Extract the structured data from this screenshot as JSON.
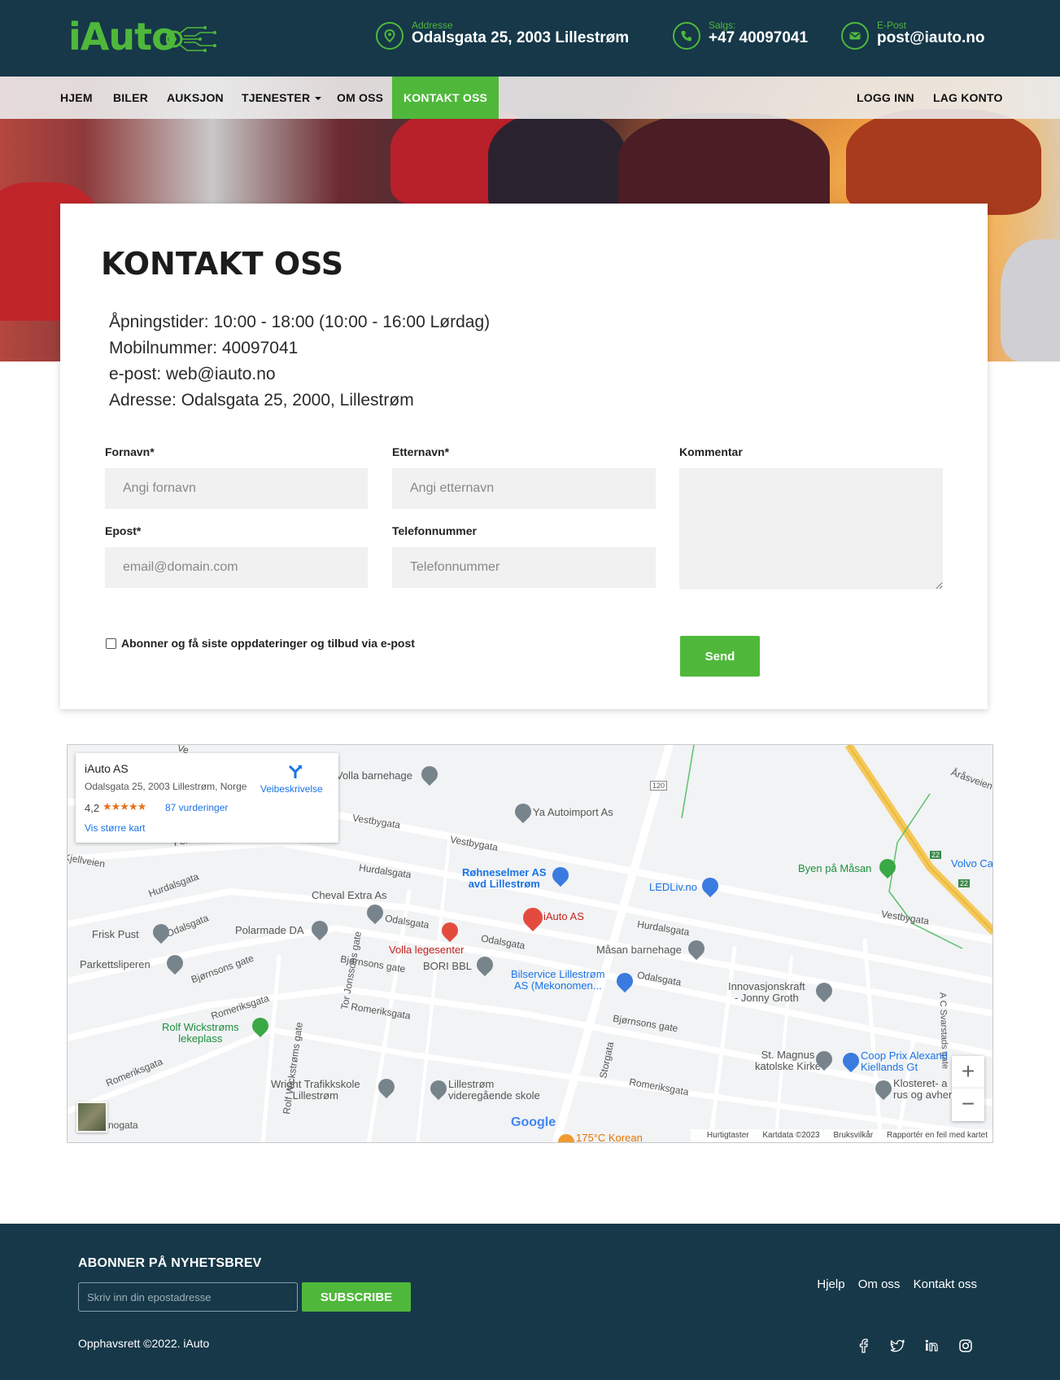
{
  "header": {
    "logo": "iAuto",
    "contacts": [
      {
        "label": "Addresse",
        "value": "Odalsgata 25, 2003 Lillestrøm",
        "icon": "location-pin-icon"
      },
      {
        "label": "Salgs:",
        "value": "+47 40097041",
        "icon": "phone-icon"
      },
      {
        "label": "E-Post",
        "value": "post@iauto.no",
        "icon": "mail-icon"
      }
    ]
  },
  "nav": {
    "items": [
      "HJEM",
      "BILER",
      "AUKSJON",
      "TJENESTER",
      "OM OSS",
      "KONTAKT OSS"
    ],
    "right": [
      "LOGG INN",
      "LAG KONTO"
    ]
  },
  "contact": {
    "title": "KONTAKT OSS",
    "info": [
      "Åpningstider: 10:00 - 18:00 (10:00 - 16:00 Lørdag)",
      "Mobilnummer: 40097041",
      "e-post: web@iauto.no",
      "Adresse: Odalsgata 25, 2000, Lillestrøm"
    ],
    "form": {
      "first_name_label": "Fornavn*",
      "first_name_placeholder": "Angi fornavn",
      "last_name_label": "Etternavn*",
      "last_name_placeholder": "Angi etternavn",
      "comment_label": "Kommentar",
      "email_label": "Epost*",
      "email_placeholder": "email@domain.com",
      "phone_label": "Telefonnummer",
      "phone_placeholder": "Telefonnummer",
      "subscribe_label": "Abonner og få siste oppdateringer og tilbud via e-post",
      "send_label": "Send"
    }
  },
  "map": {
    "card": {
      "name": "iAuto AS",
      "address": "Odalsgata 25, 2003 Lillestrøm, Norge",
      "rating": "4,2",
      "stars": "★★★★★",
      "reviews": "87 vurderinger",
      "larger_map": "Vis større kart",
      "directions": "Veibeskrivelse"
    },
    "streets": [
      "Vestbygata",
      "Vestbygata",
      "Hurdalsgata",
      "Hurdalsgata",
      "Hurdalsgata",
      "Odalsgata",
      "Odalsgata",
      "Odalsgata",
      "Odalsgata",
      "Bjørnsons gate",
      "Bjørnsons gate",
      "Bjørnsons gate",
      "Romeriksgata",
      "Romeriksgata",
      "Romeriksgata",
      "Romeriksgata",
      "Storgata",
      "Tor Jonssons gate",
      "Rolf Wickstrøms gate",
      "A C Svarstads gate",
      "Åråsveien",
      "Fernanda",
      "Kjellveien",
      "nogata",
      "120",
      "22",
      "22",
      "Ve"
    ],
    "pois": {
      "main": "iAuto AS",
      "volla_barnehage": "Volla barnehage",
      "ya_autoimport": "Ya Autoimport As",
      "rohneselmer": "Røhneselmer AS\navd Lillestrøm",
      "ledliv": "LEDLiv.no",
      "byen_pa_masan": "Byen på Måsan",
      "volvo": "Volvo Ca",
      "cheval": "Cheval Extra As",
      "polarmade": "Polarmade DA",
      "frisk_pust": "Frisk Pust",
      "parkettsliperen": "Parkettsliperen",
      "volla_legesenter": "Volla legesenter",
      "bori": "BORI BBL",
      "masan_barnehage": "Måsan barnehage",
      "bilservice": "Bilservice Lillestrøm\nAS (Mekonomen...",
      "innovasjonskraft": "Innovasjonskraft\n- Jonny Groth",
      "rolf": "Rolf Wickstrøms\nlekeplass",
      "st_magnus": "St. Magnus\nkatolske Kirke",
      "coop": "Coop Prix Alexand\nKiellands Gt",
      "klosteret": "Klosteret- a\nrus og avhengighet",
      "wright": "Wright Trafikkskole\nLillestrøm",
      "vgs": "Lillestrøm\nvideregående skole",
      "korean": "175°C Korean"
    },
    "attribution": [
      "Hurtigtaster",
      "Kartdata ©2023",
      "Bruksvilkår",
      "Rapportér en feil med kartet"
    ],
    "google": "Google",
    "zoom_in": "+",
    "zoom_out": "−"
  },
  "footer": {
    "newsletter_title": "ABONNER PÅ NYHETSBREV",
    "newsletter_placeholder": "Skriv inn din epostadresse",
    "subscribe_button": "SUBSCRIBE",
    "copyright": "Opphavsrett ©2022. iAuto",
    "links": [
      "Hjelp",
      "Om oss",
      "Kontakt oss"
    ],
    "social": [
      "facebook-icon",
      "twitter-icon",
      "linkedin-icon",
      "instagram-icon"
    ]
  },
  "colors": {
    "brand_green": "#4fb83b",
    "dark_teal": "#163849"
  }
}
